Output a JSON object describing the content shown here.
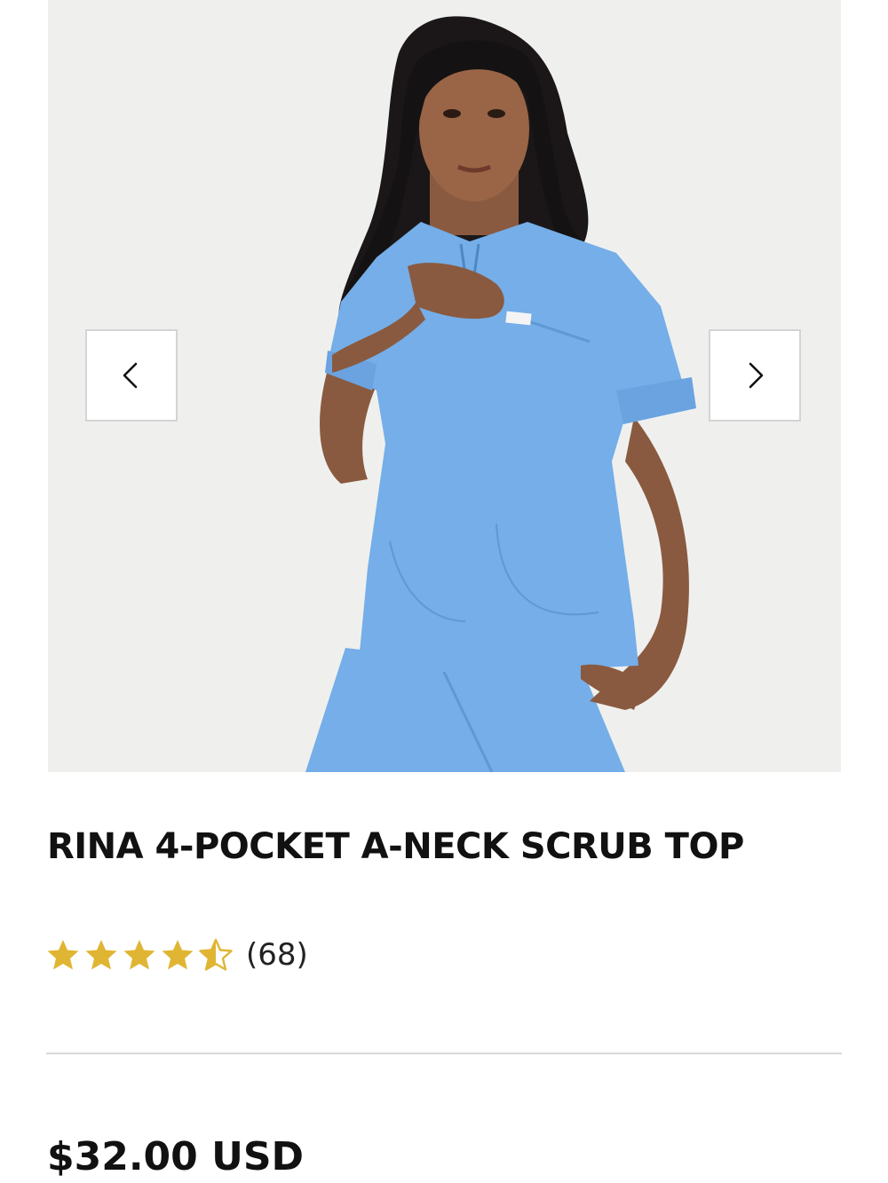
{
  "product": {
    "title": "RINA 4-POCKET A-NECK SCRUB TOP",
    "rating": 4.5,
    "rating_max": 5,
    "review_count": "(68)",
    "price": "$32.00 USD",
    "image_alt": "Model wearing light blue scrub top"
  },
  "gallery": {
    "prev_icon": "chevron-left-icon",
    "next_icon": "chevron-right-icon"
  },
  "colors": {
    "scrub_blue": "#75aee8",
    "star_gold": "#e0b533",
    "image_background": "#eff0ee"
  }
}
